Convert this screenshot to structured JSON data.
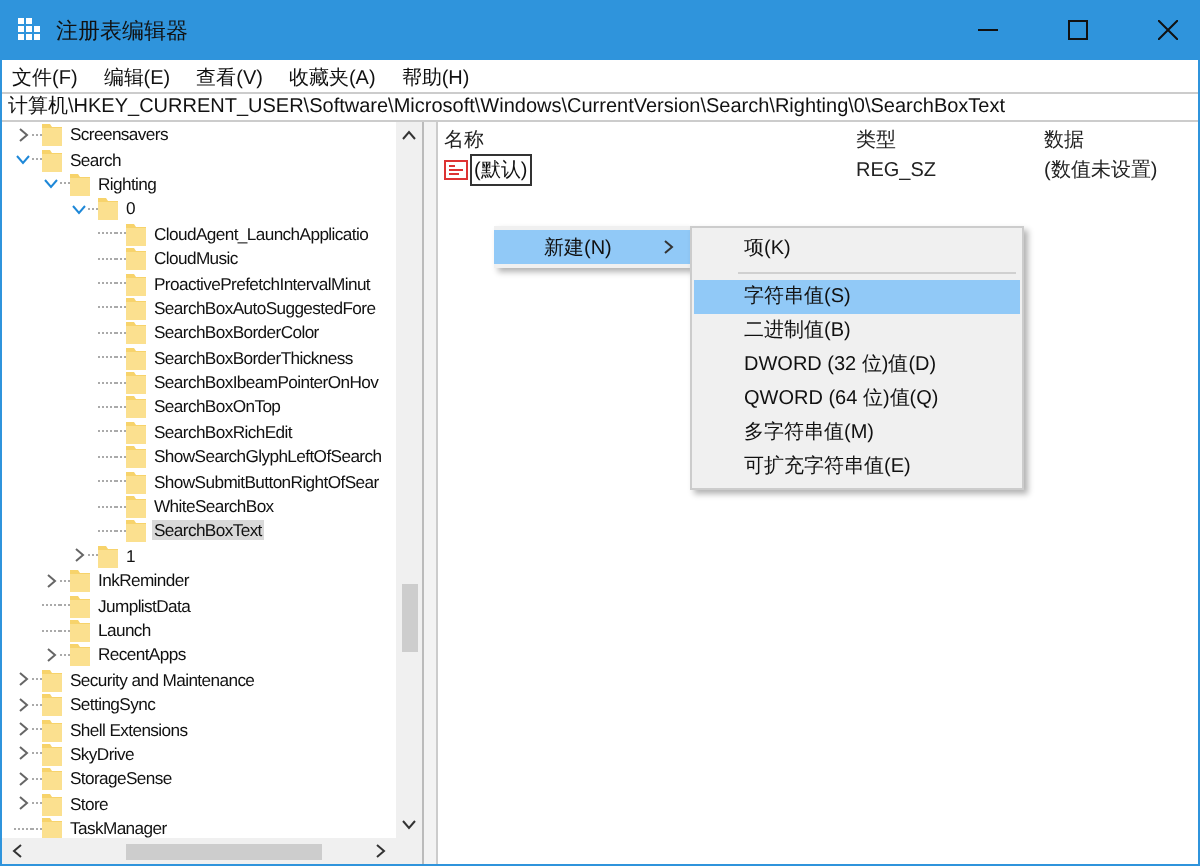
{
  "window": {
    "title": "注册表编辑器"
  },
  "menu_bar": [
    {
      "label": "文件(F)"
    },
    {
      "label": "编辑(E)"
    },
    {
      "label": "查看(V)"
    },
    {
      "label": "收藏夹(A)"
    },
    {
      "label": "帮助(H)"
    }
  ],
  "address_bar": {
    "value": "计算机\\HKEY_CURRENT_USER\\Software\\Microsoft\\Windows\\CurrentVersion\\Search\\Righting\\0\\SearchBoxText"
  },
  "tree": [
    {
      "label": "Screensavers",
      "kind": "collapsed",
      "selected": false
    },
    {
      "label": "Search",
      "kind": "expanded",
      "selected": false,
      "children": [
        {
          "label": "Righting",
          "kind": "expanded",
          "selected": false,
          "children": [
            {
              "label": "0",
              "kind": "expanded",
              "selected": false,
              "children": [
                {
                  "label": "CloudAgent_LaunchApplicatio",
                  "kind": "leaf",
                  "selected": false
                },
                {
                  "label": "CloudMusic",
                  "kind": "leaf",
                  "selected": false
                },
                {
                  "label": "ProactivePrefetchIntervalMinut",
                  "kind": "leaf",
                  "selected": false
                },
                {
                  "label": "SearchBoxAutoSuggestedFore",
                  "kind": "leaf",
                  "selected": false
                },
                {
                  "label": "SearchBoxBorderColor",
                  "kind": "leaf",
                  "selected": false
                },
                {
                  "label": "SearchBoxBorderThickness",
                  "kind": "leaf",
                  "selected": false
                },
                {
                  "label": "SearchBoxIbeamPointerOnHov",
                  "kind": "leaf",
                  "selected": false
                },
                {
                  "label": "SearchBoxOnTop",
                  "kind": "leaf",
                  "selected": false
                },
                {
                  "label": "SearchBoxRichEdit",
                  "kind": "leaf",
                  "selected": false
                },
                {
                  "label": "ShowSearchGlyphLeftOfSearch",
                  "kind": "leaf",
                  "selected": false
                },
                {
                  "label": "ShowSubmitButtonRightOfSear",
                  "kind": "leaf",
                  "selected": false
                },
                {
                  "label": "WhiteSearchBox",
                  "kind": "leaf",
                  "selected": false
                },
                {
                  "label": "SearchBoxText",
                  "kind": "leaf",
                  "selected": true
                }
              ]
            },
            {
              "label": "1",
              "kind": "collapsed",
              "selected": false
            }
          ]
        },
        {
          "label": "InkReminder",
          "kind": "collapsed",
          "selected": false
        },
        {
          "label": "JumplistData",
          "kind": "leaf",
          "selected": false
        },
        {
          "label": "Launch",
          "kind": "leaf",
          "selected": false
        },
        {
          "label": "RecentApps",
          "kind": "collapsed",
          "selected": false
        }
      ]
    },
    {
      "label": "Security and Maintenance",
      "kind": "collapsed",
      "selected": false
    },
    {
      "label": "SettingSync",
      "kind": "collapsed",
      "selected": false
    },
    {
      "label": "Shell Extensions",
      "kind": "collapsed",
      "selected": false
    },
    {
      "label": "SkyDrive",
      "kind": "collapsed",
      "selected": false
    },
    {
      "label": "StorageSense",
      "kind": "collapsed",
      "selected": false
    },
    {
      "label": "Store",
      "kind": "collapsed",
      "selected": false
    },
    {
      "label": "TaskManager",
      "kind": "leaf",
      "selected": false
    }
  ],
  "values_table": {
    "columns": [
      "名称",
      "类型",
      "数据"
    ],
    "rows": [
      {
        "name": "(默认)",
        "type": "REG_SZ",
        "data": "(数值未设置)",
        "editing": true
      }
    ]
  },
  "context_menu": {
    "items": [
      {
        "label": "新建(N)",
        "selected": true,
        "kind": "submenu"
      }
    ]
  },
  "submenu": {
    "items": [
      {
        "kind": "item",
        "label": "项(K)",
        "selected": false
      },
      {
        "kind": "separator"
      },
      {
        "kind": "item",
        "label": "字符串值(S)",
        "selected": true
      },
      {
        "kind": "item",
        "label": "二进制值(B)",
        "selected": false
      },
      {
        "kind": "item",
        "label": "DWORD (32 位)值(D)",
        "selected": false
      },
      {
        "kind": "item",
        "label": "QWORD (64 位)值(Q)",
        "selected": false
      },
      {
        "kind": "item",
        "label": "多字符串值(M)",
        "selected": false
      },
      {
        "kind": "item",
        "label": "可扩充字符串值(E)",
        "selected": false
      }
    ]
  }
}
